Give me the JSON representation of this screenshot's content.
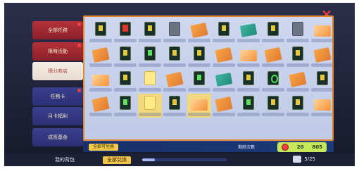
{
  "close_icon": "×",
  "sidebar": {
    "items": [
      {
        "label": "全部任務",
        "variant": "red",
        "badge": true
      },
      {
        "label": "限時活動",
        "variant": "red",
        "badge": true
      },
      {
        "label": "積分商店",
        "variant": "active",
        "badge": false
      },
      {
        "label": "任務卡",
        "variant": "blue",
        "badge": true
      },
      {
        "label": "月卡福利",
        "variant": "blue",
        "badge": false
      },
      {
        "label": "成長基金",
        "variant": "blue",
        "badge": false
      }
    ]
  },
  "grid": {
    "items": [
      {
        "thumb": "book",
        "highlight": false
      },
      {
        "thumb": "redbook",
        "highlight": false
      },
      {
        "thumb": "book",
        "highlight": false
      },
      {
        "thumb": "gray",
        "highlight": false
      },
      {
        "thumb": "card",
        "highlight": false
      },
      {
        "thumb": "book",
        "highlight": false
      },
      {
        "thumb": "mint",
        "highlight": false
      },
      {
        "thumb": "book",
        "highlight": false
      },
      {
        "thumb": "gray",
        "highlight": false
      },
      {
        "thumb": "ticket",
        "highlight": false
      },
      {
        "thumb": "card",
        "highlight": false
      },
      {
        "thumb": "book",
        "highlight": false
      },
      {
        "thumb": "greenbook",
        "highlight": false
      },
      {
        "thumb": "book",
        "highlight": false
      },
      {
        "thumb": "book",
        "highlight": false
      },
      {
        "thumb": "card",
        "highlight": false
      },
      {
        "thumb": "ticket",
        "highlight": false
      },
      {
        "thumb": "card",
        "highlight": false
      },
      {
        "thumb": "book",
        "highlight": false
      },
      {
        "thumb": "card",
        "highlight": false
      },
      {
        "thumb": "ticket",
        "highlight": false
      },
      {
        "thumb": "book",
        "highlight": false
      },
      {
        "thumb": "yellow",
        "highlight": false
      },
      {
        "thumb": "card",
        "highlight": false
      },
      {
        "thumb": "greenbook",
        "highlight": false
      },
      {
        "thumb": "mint",
        "highlight": false
      },
      {
        "thumb": "book",
        "highlight": false
      },
      {
        "thumb": "dark-green",
        "highlight": false
      },
      {
        "thumb": "card",
        "highlight": false
      },
      {
        "thumb": "book",
        "highlight": false
      },
      {
        "thumb": "card",
        "highlight": false
      },
      {
        "thumb": "greenbook",
        "highlight": false
      },
      {
        "thumb": "yellow",
        "highlight": true
      },
      {
        "thumb": "book",
        "highlight": false
      },
      {
        "thumb": "ticket",
        "highlight": true
      },
      {
        "thumb": "card",
        "highlight": false
      },
      {
        "thumb": "greenbook",
        "highlight": false
      },
      {
        "thumb": "book",
        "highlight": false
      },
      {
        "thumb": "book",
        "highlight": false
      },
      {
        "thumb": "ticket",
        "highlight": false
      }
    ]
  },
  "bottom_strip": {
    "badge": "全部可兌換",
    "tip": "剩餘次數",
    "pill_left": "20",
    "pill_right": "805"
  },
  "footer": {
    "left": "我的背包",
    "center": "全部兌換",
    "right": "5/25",
    "progress": 0.15
  },
  "colors": {
    "accent_orange": "#e08a2d",
    "close_red": "#f03a3a",
    "sidebar_red": "#b3323a",
    "sidebar_blue": "#3a3f8f"
  }
}
